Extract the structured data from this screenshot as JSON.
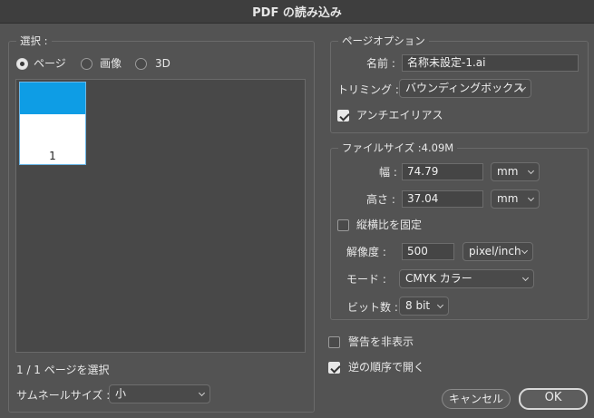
{
  "window": {
    "title": "PDF の読み込み"
  },
  "select_group": {
    "legend": "選択 :",
    "radios": [
      {
        "label": "ページ",
        "selected": true
      },
      {
        "label": "画像",
        "selected": false
      },
      {
        "label": "3D",
        "selected": false
      }
    ],
    "thumbnails": [
      {
        "page_number": "1",
        "top_color": "#0e9de5"
      }
    ],
    "page_count_text": "1 / 1 ページを選択",
    "thumbnail_size_label": "サムネールサイズ :",
    "thumbnail_size_value": "小"
  },
  "page_options": {
    "legend": "ページオプション",
    "name_label": "名前 :",
    "name_value": "名称未設定-1.ai",
    "trim_label": "トリミング :",
    "trim_value": "バウンディングボックス",
    "antialias_label": "アンチエイリアス",
    "antialias_checked": true
  },
  "file_size": {
    "legend": "ファイルサイズ :4.09M",
    "width_label": "幅 :",
    "width_value": "74.79",
    "width_unit": "mm",
    "height_label": "高さ :",
    "height_value": "37.04",
    "height_unit": "mm",
    "constrain_label": "縦横比を固定",
    "constrain_checked": false,
    "resolution_label": "解像度 :",
    "resolution_value": "500",
    "resolution_unit": "pixel/inch",
    "mode_label": "モード :",
    "mode_value": "CMYK カラー",
    "bitdepth_label": "ビット数 :",
    "bitdepth_value": "8 bit"
  },
  "options": {
    "suppress_warnings_label": "警告を非表示",
    "suppress_warnings_checked": false,
    "reverse_order_label": "逆の順序で開く",
    "reverse_order_checked": true
  },
  "buttons": {
    "cancel": "キャンセル",
    "ok": "OK"
  }
}
